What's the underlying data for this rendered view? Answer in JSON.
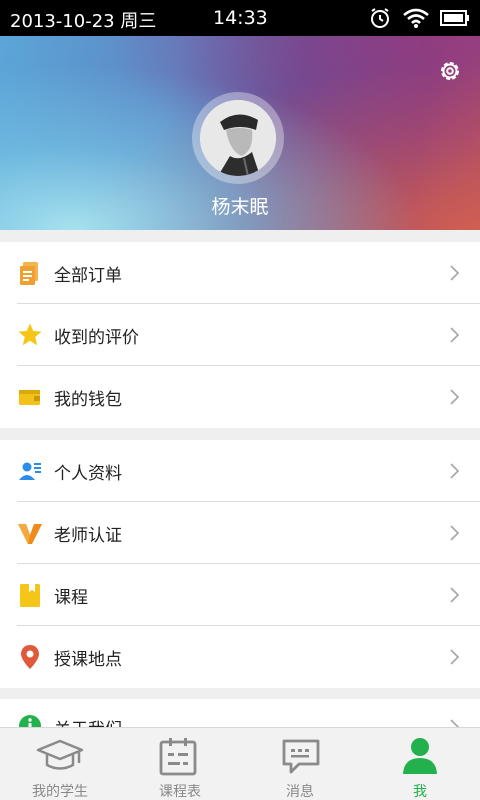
{
  "status_bar": {
    "date": "2013-10-23 周三",
    "time": "14:33"
  },
  "profile": {
    "name": "杨末眠"
  },
  "menu_group_1": [
    {
      "label": "全部订单",
      "icon": "orders-icon"
    },
    {
      "label": "收到的评价",
      "icon": "star-icon"
    },
    {
      "label": "我的钱包",
      "icon": "wallet-icon"
    }
  ],
  "menu_group_2": [
    {
      "label": "个人资料",
      "icon": "profile-card-icon"
    },
    {
      "label": "老师认证",
      "icon": "teacher-verify-icon"
    },
    {
      "label": "课程",
      "icon": "course-book-icon"
    },
    {
      "label": "授课地点",
      "icon": "location-pin-icon"
    }
  ],
  "menu_group_3": [
    {
      "label": "关于我们",
      "icon": "about-icon"
    }
  ],
  "tabs": [
    {
      "label": "我的学生",
      "icon": "graduation-cap-icon",
      "active": false
    },
    {
      "label": "课程表",
      "icon": "calendar-icon",
      "active": false
    },
    {
      "label": "消息",
      "icon": "message-icon",
      "active": false
    },
    {
      "label": "我",
      "icon": "person-icon",
      "active": true
    }
  ],
  "colors": {
    "accent": "#22b14c",
    "orders": "#f0a030",
    "star": "#f5c518",
    "wallet": "#f2c21a",
    "profile": "#2a8ee8",
    "verify": "#f08a18",
    "location": "#e05a3a"
  }
}
